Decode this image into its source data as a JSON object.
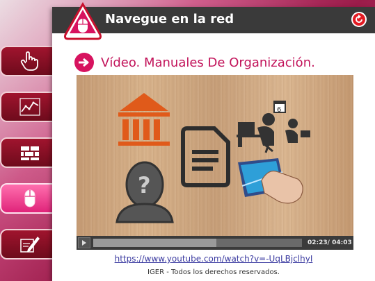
{
  "header": {
    "title": "Navegue en la red"
  },
  "section": {
    "subtitle": "Vídeo. Manuales De Organización."
  },
  "video": {
    "current_time": "02:23",
    "duration": "04:03",
    "progress": 0.59,
    "calendar_day": "6"
  },
  "link": {
    "url": "https://www.youtube.com/watch?v=-UqLBjclhyI"
  },
  "footer": {
    "copyright": "IGER - Todos los derechos reservados."
  },
  "sidebar": {
    "items": [
      {
        "icon": "hand-pointer-icon"
      },
      {
        "icon": "chart-icon"
      },
      {
        "icon": "bricks-icon"
      },
      {
        "icon": "mouse-icon",
        "active": true
      },
      {
        "icon": "pencil-document-icon"
      }
    ]
  },
  "colors": {
    "accent": "#d7135f",
    "titlebar": "#3a3a3a",
    "sidebar": "#8a0f25"
  }
}
